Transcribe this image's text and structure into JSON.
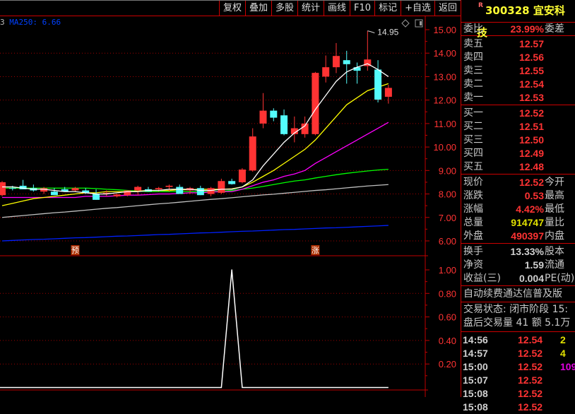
{
  "toolbar": {
    "buttons": [
      "复权",
      "叠加",
      "多股",
      "统计",
      "画线",
      "F10",
      "标记",
      "+自选",
      "返回"
    ]
  },
  "legend": {
    "prefix": "3",
    "ma250": "MA250: 6.66"
  },
  "main_chart": {
    "type": "candlestick",
    "y_ticks": [
      "15.00",
      "14.00",
      "13.00",
      "12.00",
      "11.00",
      "10.00",
      "9.00",
      "8.00",
      "7.00",
      "6.00"
    ],
    "ylim": [
      6,
      15
    ],
    "high_label": "14.95",
    "markers": [
      {
        "index": 7,
        "text": "预"
      },
      {
        "index": 30,
        "text": "涨"
      }
    ],
    "colors": {
      "up": "#ff3333",
      "down": "#54fcfc",
      "ma5": "#ffffff",
      "ma10": "#ffff00",
      "ma20": "#ff00ff",
      "ma30": "#00ff00",
      "ma60": "#c0c0c0",
      "ma250": "#0020ff",
      "axis": "#c00000",
      "grid": "#a00000"
    },
    "candles": [
      [
        7.95,
        8.55,
        7.9,
        8.5
      ],
      [
        8.25,
        8.35,
        8.15,
        8.22
      ],
      [
        8.35,
        8.6,
        8.2,
        8.2
      ],
      [
        8.25,
        8.4,
        8.1,
        8.15
      ],
      [
        8.1,
        8.3,
        8.0,
        8.25
      ],
      [
        8.1,
        8.25,
        7.95,
        7.95
      ],
      [
        8.2,
        8.3,
        8.1,
        8.1
      ],
      [
        8.15,
        8.3,
        8.1,
        8.25
      ],
      [
        8.15,
        8.25,
        8.0,
        8.05
      ],
      [
        8.0,
        8.2,
        7.75,
        7.75
      ],
      [
        8.05,
        8.15,
        7.9,
        8.05
      ],
      [
        7.9,
        8.0,
        7.85,
        7.98
      ],
      [
        7.95,
        8.15,
        7.9,
        8.15
      ],
      [
        8.15,
        8.35,
        7.95,
        8.3
      ],
      [
        8.2,
        8.3,
        8.1,
        8.1
      ],
      [
        8.2,
        8.3,
        8.1,
        8.25
      ],
      [
        8.3,
        8.4,
        8.1,
        8.35
      ],
      [
        8.3,
        8.4,
        8.1,
        8.0
      ],
      [
        8.15,
        8.3,
        8.0,
        8.25
      ],
      [
        8.25,
        8.35,
        7.95,
        7.95
      ],
      [
        8.0,
        8.3,
        7.9,
        8.25
      ],
      [
        8.05,
        8.65,
        8.0,
        8.55
      ],
      [
        8.55,
        8.65,
        8.4,
        8.42
      ],
      [
        8.5,
        9.1,
        8.45,
        9.04
      ],
      [
        9.0,
        10.8,
        8.95,
        10.45
      ],
      [
        11.0,
        12.3,
        10.8,
        11.55
      ],
      [
        11.55,
        11.65,
        11.1,
        11.25
      ],
      [
        11.35,
        11.6,
        10.5,
        10.55
      ],
      [
        10.55,
        11.3,
        10.2,
        10.8
      ],
      [
        10.55,
        11.3,
        10.4,
        11.0
      ],
      [
        10.55,
        13.2,
        10.5,
        13.16
      ],
      [
        13.0,
        13.9,
        12.75,
        13.4
      ],
      [
        13.4,
        14.43,
        13.15,
        13.88
      ],
      [
        13.7,
        14.1,
        12.7,
        13.53
      ],
      [
        13.4,
        13.6,
        12.7,
        13.25
      ],
      [
        13.45,
        14.95,
        13.25,
        13.73
      ],
      [
        13.3,
        13.7,
        11.9,
        12.02
      ],
      [
        12.14,
        12.65,
        11.85,
        12.52
      ]
    ],
    "ma5": [
      8.3,
      8.3,
      8.25,
      8.2,
      8.2,
      8.15,
      8.1,
      8.1,
      8.05,
      8.0,
      8.0,
      8.05,
      8.1,
      8.1,
      8.15,
      8.15,
      8.2,
      8.2,
      8.2,
      8.15,
      8.15,
      8.2,
      8.2,
      8.3,
      8.6,
      9.2,
      9.7,
      10.2,
      10.6,
      10.9,
      11.6,
      12.2,
      12.8,
      13.2,
      13.4,
      13.55,
      13.3,
      13.0
    ],
    "ma10": [
      7.5,
      7.6,
      7.7,
      7.8,
      7.85,
      7.9,
      7.95,
      8.0,
      8.05,
      8.05,
      8.1,
      8.1,
      8.1,
      8.12,
      8.15,
      8.15,
      8.15,
      8.18,
      8.18,
      8.2,
      8.2,
      8.2,
      8.22,
      8.3,
      8.5,
      8.75,
      9.0,
      9.3,
      9.6,
      9.9,
      10.3,
      10.8,
      11.3,
      11.8,
      12.1,
      12.4,
      12.55,
      12.7
    ],
    "ma20": [
      7.85,
      7.85,
      7.85,
      7.85,
      7.85,
      7.85,
      7.85,
      7.85,
      7.9,
      7.9,
      7.9,
      7.92,
      7.95,
      7.95,
      7.97,
      8.0,
      8.0,
      8.02,
      8.05,
      8.05,
      8.08,
      8.1,
      8.1,
      8.2,
      8.35,
      8.5,
      8.6,
      8.75,
      8.85,
      9.0,
      9.3,
      9.55,
      9.8,
      10.05,
      10.3,
      10.55,
      10.8,
      11.05
    ],
    "ma30": [
      8.25,
      8.25,
      8.25,
      8.25,
      8.25,
      8.25,
      8.25,
      8.25,
      8.25,
      8.23,
      8.2,
      8.18,
      8.15,
      8.12,
      8.1,
      8.1,
      8.1,
      8.1,
      8.1,
      8.1,
      8.1,
      8.12,
      8.15,
      8.2,
      8.25,
      8.32,
      8.4,
      8.48,
      8.55,
      8.6,
      8.68,
      8.75,
      8.82,
      8.88,
      8.93,
      8.98,
      9.02,
      9.05
    ],
    "ma60": [
      7.0,
      7.04,
      7.08,
      7.12,
      7.16,
      7.2,
      7.23,
      7.27,
      7.31,
      7.35,
      7.39,
      7.42,
      7.46,
      7.5,
      7.54,
      7.58,
      7.61,
      7.65,
      7.69,
      7.73,
      7.77,
      7.8,
      7.84,
      7.88,
      7.92,
      7.96,
      7.99,
      8.03,
      8.07,
      8.11,
      8.15,
      8.18,
      8.22,
      8.26,
      8.3,
      8.34,
      8.37,
      8.4
    ],
    "ma250": [
      6.0,
      6.02,
      6.04,
      6.06,
      6.07,
      6.09,
      6.11,
      6.13,
      6.14,
      6.16,
      6.18,
      6.2,
      6.21,
      6.23,
      6.25,
      6.27,
      6.28,
      6.3,
      6.32,
      6.34,
      6.35,
      6.37,
      6.39,
      6.41,
      6.42,
      6.44,
      6.46,
      6.48,
      6.49,
      6.51,
      6.53,
      6.55,
      6.56,
      6.58,
      6.6,
      6.62,
      6.64,
      6.66
    ]
  },
  "chart_data": {
    "type": "line",
    "title": "indicator",
    "y_ticks": [
      "1.00",
      "0.80",
      "0.60",
      "0.40",
      "0.20"
    ],
    "ylim": [
      0,
      1
    ],
    "values": [
      0,
      0,
      0,
      0,
      0,
      0,
      0,
      0,
      0,
      0,
      0,
      0,
      0,
      0,
      0,
      0,
      0,
      0,
      0,
      0,
      0,
      0,
      1,
      0,
      0,
      0,
      0,
      0,
      0,
      0,
      0,
      0,
      0,
      0,
      0,
      0,
      0,
      0
    ]
  },
  "panel": {
    "r_mark": "R",
    "code": "300328",
    "name": "宜安科技",
    "webi": {
      "label": "委比",
      "value": "23.99%",
      "right": "委差"
    },
    "sell": [
      {
        "label": "卖五",
        "price": "12.57"
      },
      {
        "label": "卖四",
        "price": "12.56"
      },
      {
        "label": "卖三",
        "price": "12.55"
      },
      {
        "label": "卖二",
        "price": "12.54"
      },
      {
        "label": "卖一",
        "price": "12.53"
      }
    ],
    "buy": [
      {
        "label": "买一",
        "price": "12.52"
      },
      {
        "label": "买二",
        "price": "12.51"
      },
      {
        "label": "买三",
        "price": "12.50"
      },
      {
        "label": "买四",
        "price": "12.49"
      },
      {
        "label": "买五",
        "price": "12.48"
      }
    ],
    "quote": [
      {
        "label": "现价",
        "value": "12.52",
        "right": "今开",
        "color": "red"
      },
      {
        "label": "涨跌",
        "value": "0.53",
        "right": "最高",
        "color": "red"
      },
      {
        "label": "涨幅",
        "value": "4.42%",
        "right": "最低",
        "color": "red"
      },
      {
        "label": "总量",
        "value": "914747",
        "right": "量比",
        "color": "yel"
      },
      {
        "label": "外盘",
        "value": "490397",
        "right": "内盘",
        "color": "red"
      }
    ],
    "fin": [
      {
        "label": "换手",
        "value": "13.33%",
        "right": "股本"
      },
      {
        "label": "净资",
        "value": "1.59",
        "right": "流通"
      },
      {
        "label": "收益(三)",
        "value": "0.004",
        "right": "PE(动)"
      }
    ],
    "notice": "自动续费通达信普及版",
    "status": "交易状态: 闭市阶段 15:",
    "after": "盘后交易量 41 额 5.1万",
    "ticks": [
      {
        "time": "14:56",
        "price": "12.54",
        "vol": "2",
        "vcolor": "yel"
      },
      {
        "time": "14:57",
        "price": "12.52",
        "vol": "4",
        "vcolor": "yel"
      },
      {
        "time": "15:00",
        "price": "12.52",
        "vol": "109",
        "vcolor": "mag"
      },
      {
        "time": "15:07",
        "price": "12.52",
        "vol": "",
        "vcolor": "yel"
      },
      {
        "time": "15:08",
        "price": "12.52",
        "vol": "",
        "vcolor": "yel"
      },
      {
        "time": "15:08",
        "price": "12.52",
        "vol": "",
        "vcolor": "yel"
      }
    ]
  }
}
